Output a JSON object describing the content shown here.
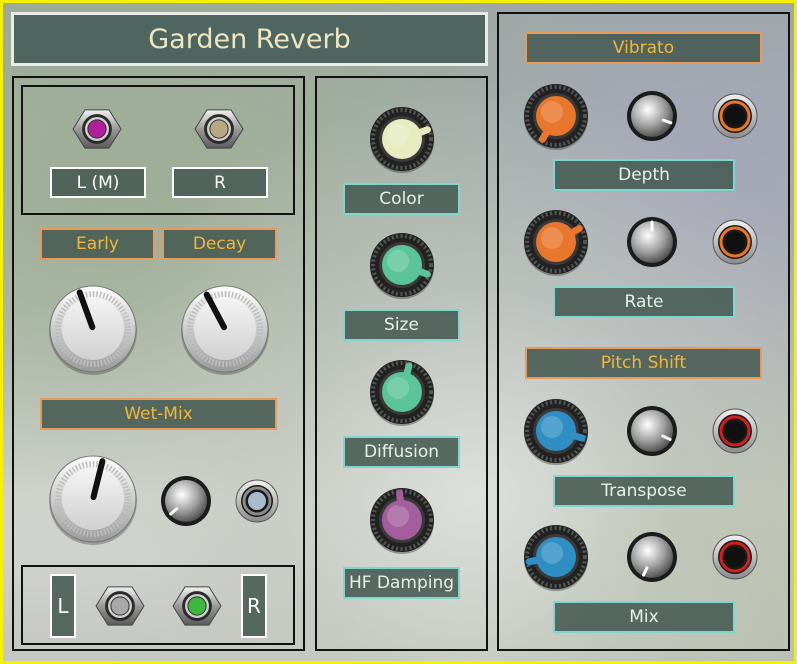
{
  "title": "Garden Reverb",
  "colors": {
    "frame": "#f4f000",
    "title_bg": "#4e6560",
    "label_orange_border": "#e89a5a",
    "label_orange_text": "#f4b63a",
    "label_teal_border": "#7fd6cc",
    "orange_knob": "#e8762c",
    "blue_knob": "#2f8fc4",
    "color_knob": "#e6ecc0",
    "size_knob": "#5cc49a",
    "diffusion_knob": "#5cc49a",
    "hf_knob": "#a45ea0"
  },
  "inputs": {
    "left_jack_label": "L (M)",
    "right_jack_label": "R",
    "left_jack_led": "#b0209a",
    "right_jack_led": "#b8a880"
  },
  "left": {
    "early_label": "Early",
    "decay_label": "Decay",
    "wet_mix_label": "Wet-Mix"
  },
  "outputs": {
    "left_label": "L",
    "right_label": "R",
    "left_jack_led": "#a8a8a8",
    "right_jack_led": "#3cb83c"
  },
  "middle": {
    "color_label": "Color",
    "size_label": "Size",
    "diffusion_label": "Diffusion",
    "hf_damping_label": "HF Damping"
  },
  "right": {
    "vibrato_label": "Vibrato",
    "depth_label": "Depth",
    "rate_label": "Rate",
    "pitch_shift_label": "Pitch Shift",
    "transpose_label": "Transpose",
    "mix_label": "Mix"
  },
  "icons": {
    "jack": "hex-jack-icon",
    "cv_port": "cv-port-icon",
    "knob": "knob-icon"
  }
}
